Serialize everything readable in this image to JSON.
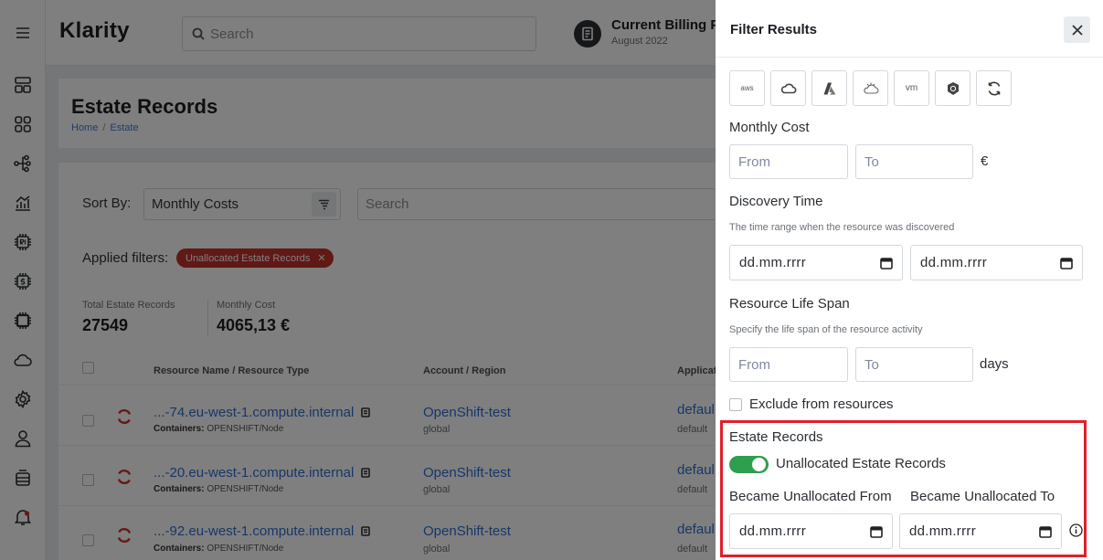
{
  "app": {
    "brand": "Klarity",
    "search_placeholder": "Search",
    "billing_title": "Current Billing P",
    "billing_period": "August 2022"
  },
  "sidebar": {
    "icons": [
      "menu-icon",
      "dashboard-icon",
      "apps-grid-icon",
      "topology-icon",
      "analytics-icon",
      "ri-chip-icon",
      "cost-chip-icon",
      "cpu-chip-icon",
      "cloud-icon",
      "settings-icon",
      "user-icon",
      "storage-icon",
      "notification-icon"
    ]
  },
  "page": {
    "title": "Estate Records",
    "breadcrumb": [
      "Home",
      "Estate"
    ]
  },
  "toolbar": {
    "sort_label": "Sort By:",
    "sort_value": "Monthly Costs",
    "search_placeholder": "Search",
    "applied_label": "Applied filters:",
    "applied_chip": "Unallocated Estate Records"
  },
  "stats": {
    "total_label": "Total Estate Records",
    "total_value": "27549",
    "cost_label": "Monthly Cost",
    "cost_value": "4065,13 €"
  },
  "table": {
    "headers": [
      "Resource Name / Resource Type",
      "Account / Region",
      "Applicat"
    ],
    "rows": [
      {
        "name": "...-74.eu-west-1.compute.internal",
        "type_label": "Containers:",
        "type": "OPENSHIFT/Node",
        "account": "OpenShift-test",
        "region": "global",
        "app": "defaul",
        "app_sub": "default"
      },
      {
        "name": "...-20.eu-west-1.compute.internal",
        "type_label": "Containers:",
        "type": "OPENSHIFT/Node",
        "account": "OpenShift-test",
        "region": "global",
        "app": "defaul",
        "app_sub": "default"
      },
      {
        "name": "...-92.eu-west-1.compute.internal",
        "type_label": "Containers:",
        "type": "OPENSHIFT/Node",
        "account": "OpenShift-test",
        "region": "global",
        "app": "defaul",
        "app_sub": "default"
      }
    ]
  },
  "filter": {
    "title": "Filter Results",
    "providers": [
      {
        "name": "aws-icon",
        "text": "aws"
      },
      {
        "name": "gcp-icon",
        "text": ""
      },
      {
        "name": "azure-icon",
        "text": ""
      },
      {
        "name": "alibaba-cloud-icon",
        "text": ""
      },
      {
        "name": "vmware-icon",
        "text": "vm"
      },
      {
        "name": "kubernetes-icon",
        "text": ""
      },
      {
        "name": "openshift-icon",
        "text": ""
      }
    ],
    "monthly_cost": {
      "label": "Monthly Cost",
      "from_placeholder": "From",
      "to_placeholder": "To",
      "unit": "€"
    },
    "discovery_time": {
      "label": "Discovery Time",
      "hint": "The time range when the resource was discovered",
      "from": "dd.mm.rrrr",
      "to": "dd.mm.rrrr"
    },
    "life_span": {
      "label": "Resource Life Span",
      "hint": "Specify the life span of the resource activity",
      "from_placeholder": "From",
      "to_placeholder": "To",
      "unit": "days"
    },
    "exclude_label": "Exclude from resources",
    "estate_records": {
      "label": "Estate Records",
      "toggle_label": "Unallocated Estate Records",
      "toggle_on": true,
      "from_label": "Became Unallocated From",
      "to_label": "Became Unallocated To",
      "from": "dd.mm.rrrr",
      "to": "dd.mm.rrrr"
    }
  },
  "colors": {
    "chip_red": "#c0322b",
    "toggle_green": "#2e9e4f",
    "highlight_red": "#e0202a",
    "link_blue": "#2f6fd0"
  }
}
